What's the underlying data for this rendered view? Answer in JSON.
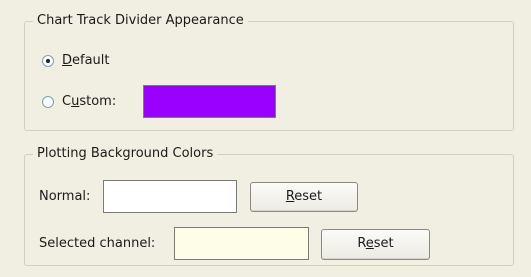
{
  "track_divider": {
    "title": "Chart Track Divider Appearance",
    "default_label_first": "D",
    "default_label_rest": "efault",
    "custom_label_first": "C",
    "custom_label_u": "u",
    "custom_label_rest": "stom:",
    "selected": "Default",
    "custom_color": "#9900ff"
  },
  "plotting_background": {
    "title": "Plotting Background Colors",
    "normal_label": "Normal:",
    "normal_color": "#ffffff",
    "reset1_u": "R",
    "reset1_rest": "eset",
    "selected_label": "Selected channel:",
    "selected_color": "#fefde8",
    "reset2_first": "R",
    "reset2_u": "e",
    "reset2_rest": "set"
  }
}
